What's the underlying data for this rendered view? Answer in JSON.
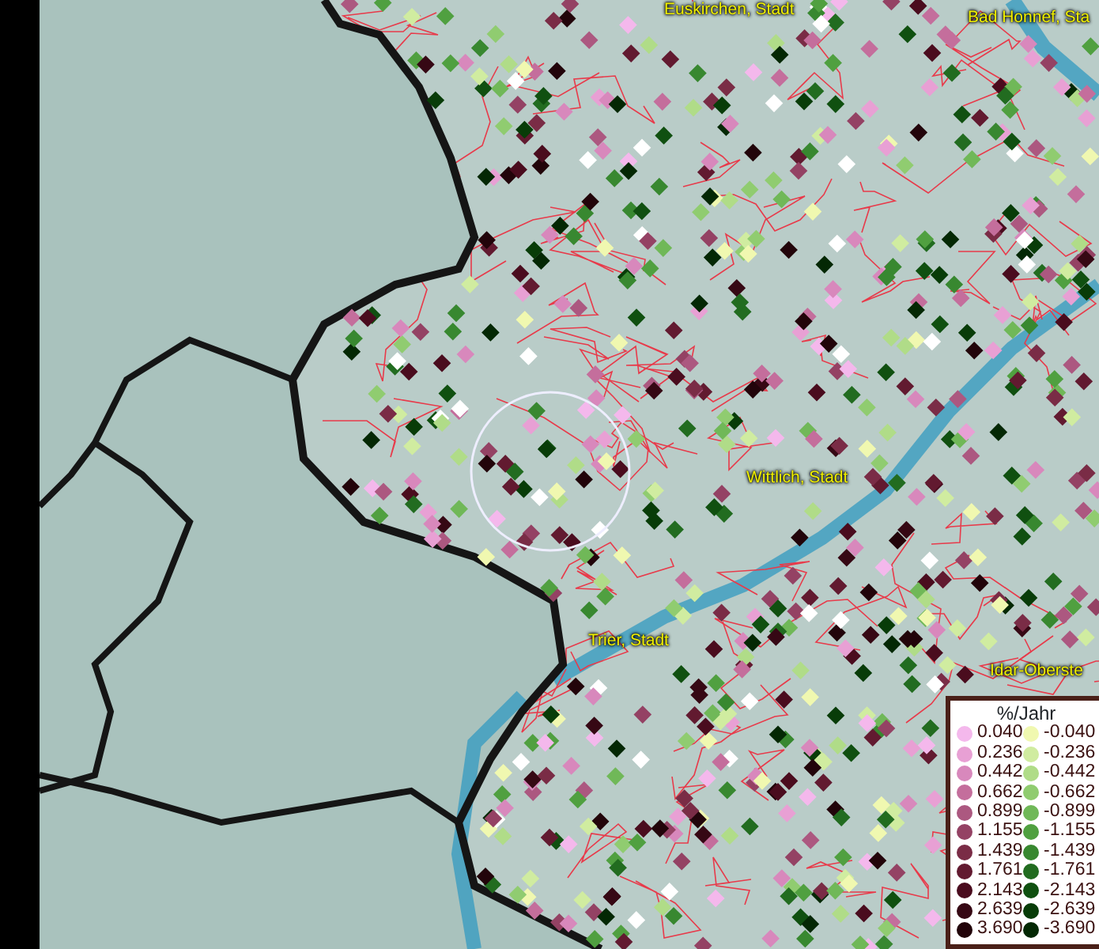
{
  "map": {
    "place_labels": [
      {
        "text": "Euskirchen, Stadt",
        "kind": "city"
      },
      {
        "text": "Bad Honnef, Sta",
        "kind": "city"
      },
      {
        "text": "Wittlich, Stadt",
        "kind": "city"
      },
      {
        "text": "Trier, Stadt",
        "kind": "city"
      },
      {
        "text": "Idar-Oberste",
        "kind": "city"
      }
    ]
  },
  "legend": {
    "title": "%/Jahr",
    "positive": [
      {
        "value": "0.040",
        "color": "#f4b8ec"
      },
      {
        "value": "0.236",
        "color": "#e8a0d4"
      },
      {
        "value": "0.442",
        "color": "#d888bc"
      },
      {
        "value": "0.662",
        "color": "#c46e9c"
      },
      {
        "value": "0.899",
        "color": "#ac5880"
      },
      {
        "value": "1.155",
        "color": "#944264"
      },
      {
        "value": "1.439",
        "color": "#7a2c46"
      },
      {
        "value": "1.761",
        "color": "#621a30"
      },
      {
        "value": "2.143",
        "color": "#4a0c1e"
      },
      {
        "value": "2.639",
        "color": "#360814"
      },
      {
        "value": "3.690",
        "color": "#22040a"
      }
    ],
    "negative": [
      {
        "value": "-0.040",
        "color": "#f0f8b0"
      },
      {
        "value": "-0.236",
        "color": "#d0eca0"
      },
      {
        "value": "-0.442",
        "color": "#b0dc88"
      },
      {
        "value": "-0.662",
        "color": "#90cc70"
      },
      {
        "value": "-0.899",
        "color": "#70b858"
      },
      {
        "value": "-1.155",
        "color": "#50a040"
      },
      {
        "value": "-1.439",
        "color": "#388830"
      },
      {
        "value": "-1.761",
        "color": "#226c20"
      },
      {
        "value": "-2.143",
        "color": "#105010"
      },
      {
        "value": "-2.639",
        "color": "#083c08"
      },
      {
        "value": "-3.690",
        "color": "#042804"
      }
    ]
  }
}
